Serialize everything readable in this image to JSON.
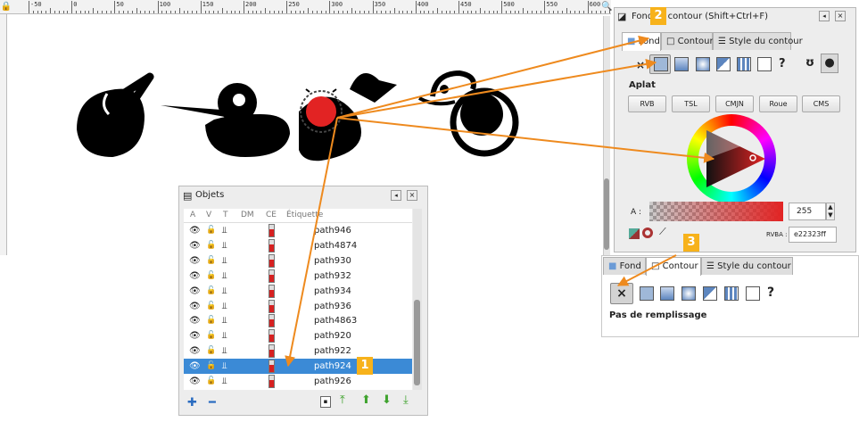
{
  "ruler": {
    "labels": [
      "-50",
      "0",
      "50",
      "100",
      "150",
      "200",
      "250",
      "300",
      "350",
      "400",
      "450",
      "500",
      "550",
      "600"
    ]
  },
  "fill_dialog": {
    "title": "Fond et contour (Shift+Ctrl+F)",
    "tabs": [
      "Fond",
      "Contour",
      "Style du contour"
    ],
    "paint_type_unset": "×",
    "paint_type_unknown": "?",
    "flat_label": "Aplat",
    "mode_buttons": [
      "RVB",
      "TSL",
      "CMJN",
      "Roue",
      "CMS"
    ],
    "alpha_label": "A :",
    "alpha_value": "255",
    "rgba_label": "RVBA :",
    "rgba_value": "e22323ff",
    "current_color": "#e22323"
  },
  "stroke_dialog": {
    "tabs": [
      "Fond",
      "Contour",
      "Style du contour"
    ],
    "paint_type_unset": "×",
    "paint_type_unknown": "?",
    "no_paint_label": "Pas de remplissage"
  },
  "objects_panel": {
    "title": "Objets",
    "columns": [
      "A",
      "V",
      "T",
      "DM",
      "CE",
      "Étiquette"
    ],
    "rows": [
      {
        "label": "path946",
        "selected": false
      },
      {
        "label": "path4874",
        "selected": false
      },
      {
        "label": "path930",
        "selected": false
      },
      {
        "label": "path932",
        "selected": false
      },
      {
        "label": "path934",
        "selected": false
      },
      {
        "label": "path936",
        "selected": false
      },
      {
        "label": "path4863",
        "selected": false
      },
      {
        "label": "path920",
        "selected": false
      },
      {
        "label": "path922",
        "selected": false
      },
      {
        "label": "path924",
        "selected": true
      },
      {
        "label": "path926",
        "selected": false
      }
    ],
    "icon_visible": "👁",
    "icon_lock": "🔓"
  },
  "callouts": [
    "1",
    "2",
    "3"
  ],
  "colors": {
    "accent_orange": "#ee8a1e",
    "callout_bg": "#f7b21b",
    "selection_blue": "#3b8ad6",
    "shape_black": "#000000",
    "selected_shape": "#e22323"
  }
}
